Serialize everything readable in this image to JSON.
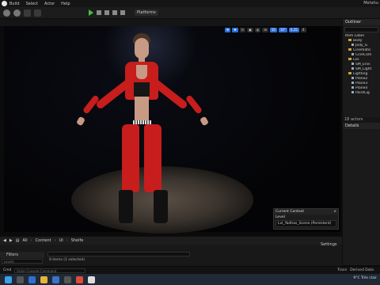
{
  "menubar": {
    "items": [
      "Build",
      "Select",
      "Actor",
      "Help"
    ],
    "title": "Metahu"
  },
  "toolbar": {
    "platforms_label": "Platforms"
  },
  "viewport": {
    "buttons": [
      "10",
      "10°",
      "0.25",
      "4"
    ]
  },
  "current_context": {
    "header": "Current Context",
    "level_label": "Level",
    "level_value": "Lvl_Yadhas_Scene (Persistent)"
  },
  "outliner": {
    "title": "Outliner",
    "header_label": "Item Label",
    "items": [
      {
        "label": "Body",
        "kind": "folder",
        "indent": 1
      },
      {
        "label": "Jody_G",
        "kind": "actor",
        "indent": 2
      },
      {
        "label": "Cinematic",
        "kind": "folder",
        "indent": 1
      },
      {
        "label": "CineCam",
        "kind": "actor",
        "indent": 2
      },
      {
        "label": "Lvs",
        "kind": "folder",
        "indent": 1
      },
      {
        "label": "SM_Envi",
        "kind": "actor",
        "indent": 2
      },
      {
        "label": "SM_Light",
        "kind": "actor",
        "indent": 2
      },
      {
        "label": "Lighting",
        "kind": "folder",
        "indent": 1
      },
      {
        "label": "Plane2",
        "kind": "actor",
        "indent": 2
      },
      {
        "label": "Plane3",
        "kind": "actor",
        "indent": 2
      },
      {
        "label": "Plane4",
        "kind": "actor",
        "indent": 2
      },
      {
        "label": "PointLig",
        "kind": "actor",
        "indent": 2
      }
    ],
    "actor_count": "18 actors"
  },
  "details": {
    "title": "Details"
  },
  "content_browser": {
    "breadcrumb": [
      "All",
      "Content",
      "UI",
      "Shelfe"
    ],
    "settings_label": "Settings",
    "filters_label": "Filters",
    "filter_placeholder": "Levels",
    "item_count": "9 items (1 selected)"
  },
  "statusbar": {
    "cmd_label": "Cmd",
    "cmd_placeholder": "Enter Console Command",
    "trace_label": "Trace",
    "derived_data_label": "Derived Data"
  },
  "taskbar": {
    "weather": "9°C",
    "weather_desc": "Très clair"
  }
}
